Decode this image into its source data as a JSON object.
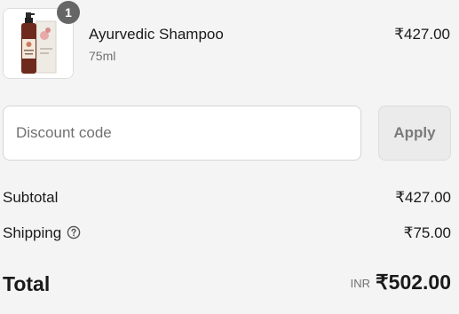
{
  "line_item": {
    "quantity": "1",
    "name": "Ayurvedic Shampoo",
    "variant": "75ml",
    "price": "₹427.00",
    "image_icon": "product-bottle-with-box"
  },
  "discount": {
    "placeholder": "Discount code",
    "value": "",
    "apply_label": "Apply"
  },
  "summary": {
    "subtotal_label": "Subtotal",
    "subtotal_value": "₹427.00",
    "shipping_label": "Shipping",
    "shipping_value": "₹75.00",
    "shipping_help_icon": "question-circle-icon",
    "total_label": "Total",
    "currency": "INR",
    "total_value": "₹502.00"
  }
}
